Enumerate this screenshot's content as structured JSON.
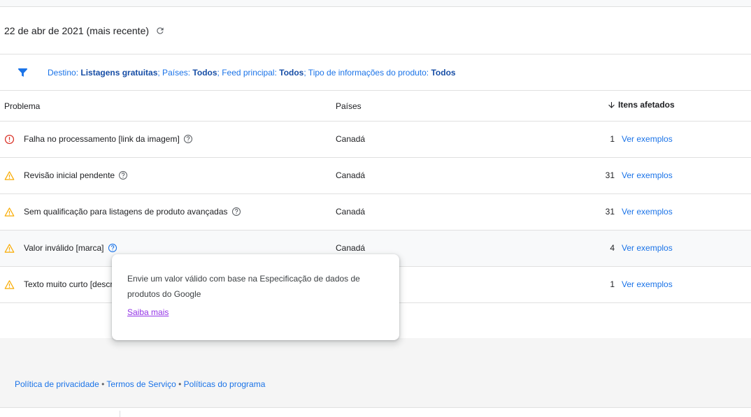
{
  "date_bar": {
    "date": "22 de abr de 2021 (mais recente)",
    "refresh_icon": "refresh-icon"
  },
  "filter": {
    "destino_label": "Destino: ",
    "destino_value": "Listagens gratuitas",
    "paises_label": "; Países: ",
    "paises_value": "Todos",
    "feed_label": "; Feed principal: ",
    "feed_value": "Todos",
    "tipo_label": "; Tipo de informações do produto: ",
    "tipo_value": "Todos"
  },
  "table": {
    "headers": {
      "problem": "Problema",
      "countries": "Países",
      "items": "Itens afetados"
    },
    "rows": [
      {
        "status": "error",
        "problem": "Falha no processamento [link da imagem]",
        "country": "Canadá",
        "count": "1",
        "link": "Ver exemplos"
      },
      {
        "status": "warning",
        "problem": "Revisão inicial pendente",
        "country": "Canadá",
        "count": "31",
        "link": "Ver exemplos"
      },
      {
        "status": "warning",
        "problem": "Sem qualificação para listagens de produto avançadas",
        "country": "Canadá",
        "count": "31",
        "link": "Ver exemplos"
      },
      {
        "status": "warning",
        "problem": "Valor inválido [marca]",
        "country": "Canadá",
        "count": "4",
        "link": "Ver exemplos"
      },
      {
        "status": "warning",
        "problem": "Texto muito curto [descriç",
        "country": "",
        "count": "1",
        "link": "Ver exemplos"
      }
    ]
  },
  "tooltip": {
    "text": "Envie um valor válido com base na Especificação de dados de produtos do Google",
    "link": "Saiba mais"
  },
  "footer": {
    "privacy": "Política de privacidade",
    "separator": " • ",
    "terms": "Termos de Serviço",
    "policies": "Políticas do programa"
  },
  "colors": {
    "accent": "#1a73e8",
    "error": "#d93025",
    "warning": "#f9ab00",
    "visited_link": "#9334e6"
  }
}
